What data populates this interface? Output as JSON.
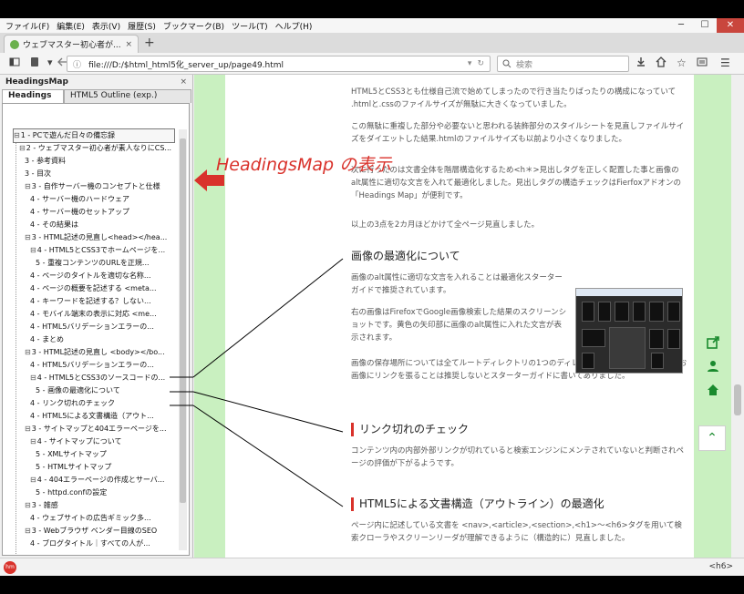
{
  "menubar": {
    "items": [
      "ファイル(F)",
      "編集(E)",
      "表示(V)",
      "履歴(S)",
      "ブックマーク(B)",
      "ツール(T)",
      "ヘルプ(H)"
    ],
    "minimize": "─",
    "maximize": "☐",
    "close": "✕"
  },
  "tab": {
    "title": "ウェブマスター初心者が...",
    "close": "×",
    "new_tab": "+"
  },
  "navbar": {
    "url": "file:///D:/$html_html5化_server_up/page49.html",
    "search_placeholder": "検索",
    "reload": "↻",
    "dropdown": "▾"
  },
  "sidebar": {
    "title": "HeadingsMap",
    "close": "×",
    "tabs": [
      "Headings",
      "HTML5 Outline (exp.)"
    ],
    "tree": [
      {
        "level": 1,
        "label": "1 - PCで遊んだ日々の備忘録",
        "glyph": "⊟",
        "selected": true
      },
      {
        "level": 2,
        "label": "2 - ウェブマスター初心者が素人なりにCS...",
        "glyph": "⊟"
      },
      {
        "level": 3,
        "label": "3 - 参考資料",
        "glyph": ""
      },
      {
        "level": 3,
        "label": "3 - 目次",
        "glyph": ""
      },
      {
        "level": 3,
        "label": "3 - 自作サーバー機のコンセプトと仕様",
        "glyph": "⊟"
      },
      {
        "level": 4,
        "label": "4 - サーバー機のハードウェア",
        "glyph": ""
      },
      {
        "level": 4,
        "label": "4 - サーバー機のセットアップ",
        "glyph": ""
      },
      {
        "level": 4,
        "label": "4 - その結果は",
        "glyph": ""
      },
      {
        "level": 3,
        "label": "3 - HTML記述の見直し<head></hea...",
        "glyph": "⊟"
      },
      {
        "level": 4,
        "label": "4 - HTML5とCSS3でホームページを...",
        "glyph": "⊟"
      },
      {
        "level": 5,
        "label": "5 - 重複コンテンツのURLを正規...",
        "glyph": ""
      },
      {
        "level": 4,
        "label": "4 - ページのタイトルを適切な名称...",
        "glyph": ""
      },
      {
        "level": 4,
        "label": "4 - ページの概要を記述する <meta...",
        "glyph": ""
      },
      {
        "level": 4,
        "label": "4 - キーワードを記述する？しない...",
        "glyph": ""
      },
      {
        "level": 4,
        "label": "4 - モバイル端末の表示に対応 <me...",
        "glyph": ""
      },
      {
        "level": 4,
        "label": "4 - HTML5バリデーションエラーの...",
        "glyph": ""
      },
      {
        "level": 4,
        "label": "4 - まとめ",
        "glyph": ""
      },
      {
        "level": 3,
        "label": "3 - HTML記述の見直し <body></bo...",
        "glyph": "⊟"
      },
      {
        "level": 4,
        "label": "4 - HTML5バリデーションエラーの...",
        "glyph": ""
      },
      {
        "level": 4,
        "label": "4 - HTML5とCSS3のソースコードの...",
        "glyph": "⊟"
      },
      {
        "level": 5,
        "label": "5 - 画像の最適化について",
        "glyph": ""
      },
      {
        "level": 4,
        "label": "4 - リンク切れのチェック",
        "glyph": ""
      },
      {
        "level": 4,
        "label": "4 - HTML5による文書構造（アウト...",
        "glyph": ""
      },
      {
        "level": 3,
        "label": "3 - サイトマップと404エラーページを...",
        "glyph": "⊟"
      },
      {
        "level": 4,
        "label": "4 - サイトマップについて",
        "glyph": "⊟"
      },
      {
        "level": 5,
        "label": "5 - XMLサイトマップ",
        "glyph": ""
      },
      {
        "level": 5,
        "label": "5 - HTMLサイトマップ",
        "glyph": ""
      },
      {
        "level": 4,
        "label": "4 - 404エラーページの作成とサーバ...",
        "glyph": "⊟"
      },
      {
        "level": 5,
        "label": "5 - httpd.confの設定",
        "glyph": ""
      },
      {
        "level": 3,
        "label": "3 - 雑感",
        "glyph": "⊟"
      },
      {
        "level": 4,
        "label": "4 - ウェブサイトの広告ギミック多...",
        "glyph": ""
      },
      {
        "level": 3,
        "label": "3 - Webブラウザ ベンダー目線のSEO",
        "glyph": "⊟"
      },
      {
        "level": 4,
        "label": "4 - ブログタイトル｜すべての人が...",
        "glyph": ""
      }
    ]
  },
  "annotation": {
    "label": "HeadingsMap の表示",
    "color": "#d9322b"
  },
  "article": {
    "p1": "HTML5とCSS3とも仕様自己流で始めてしまったので行き当たりばったりの構成になっていて .htmlと.cssのファイルサイズが無駄に大きくなっていました。",
    "p2": "この無駄に重複した部分や必要ないと思われる装飾部分のスタイルシートを見直しファイルサイズをダイエットした結果.htmlのファイルサイズも以前より小さくなりました。",
    "p3": "次に行ったのは文書全体を階層構造化するため<h＊>見出しタグを正しく配置した事と画像のalt属性に適切な文言を入れて最適化しました。見出しタグの構造チェックはFierfoxアドオンの「Headings Map」が便利です。",
    "p4": "以上の3点を2カ月ほどかけて全ページ見直しました。",
    "h_image": "画像の最適化について",
    "p5": "画像のalt属性に適切な文言を入れることは最適化スターターガイドで推奨されています。",
    "p6": "右の画像はFirefoxでGoogle画像検索した結果のスクリーンショットです。黄色の矢印部に画像のalt属性に入れた文言が表示されます。",
    "p7": "画像の保存場所については全てルートディレクトリの1つのディレクトリに保存しています。なお画像にリンクを張ることは推奨しないとスターターガイドに書いてありました。",
    "h_link": "リンク切れのチェック",
    "p8": "コンテンツ内の内部外部リンクが切れていると検索エンジンにメンテされていないと判断されページの評価が下がるようです。",
    "h_html5": "HTML5による文書構造（アウトライン）の最適化",
    "p9": "ページ内に記述している文書を <nav>,<article>,<section>,<h1>～<h6>タグを用いて検索クローラやスクリーンリーダが理解できるように（構造的に）見直しました。"
  },
  "side_icons": [
    "share-icon",
    "user-icon",
    "home-icon"
  ],
  "to_top": "⌃",
  "statusbar": {
    "badge": "hm",
    "right_text": "<h6>"
  },
  "icon_names": {
    "sidebar_toggle": "sidebar-icon",
    "pocket": "pocket-icon",
    "back": "back-arrow-icon",
    "info": "info-icon",
    "download": "download-icon",
    "home": "home-icon",
    "bookmark": "star-icon",
    "reader": "reader-icon",
    "menu": "hamburger-menu-icon"
  },
  "colors": {
    "accent_red": "#d9322b",
    "green_bg": "#c9f0c0",
    "green_icon": "#1a8a2e"
  }
}
